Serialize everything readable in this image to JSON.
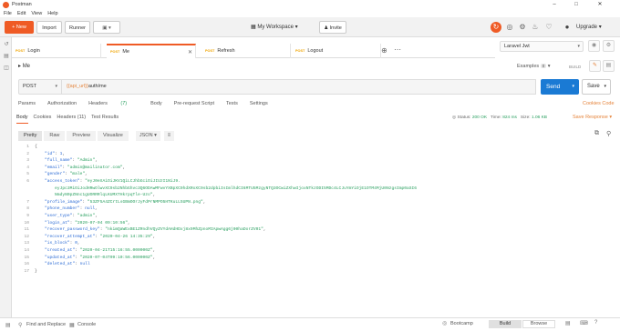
{
  "window": {
    "title": "Postman",
    "min_icon": "minimize-icon",
    "max_icon": "maximize-icon",
    "close_icon": "close-icon"
  },
  "menu": [
    "File",
    "Edit",
    "View",
    "Help"
  ],
  "toolbar": {
    "new_label": "New",
    "import_label": "Import",
    "runner_label": "Runner",
    "workspace_label": "My Workspace",
    "invite_label": "Invite",
    "upgrade_label": "Upgrade"
  },
  "tabs": [
    {
      "method": "POST",
      "name": "Login"
    },
    {
      "method": "POST",
      "name": "Me"
    },
    {
      "method": "POST",
      "name": "Refresh"
    },
    {
      "method": "POST",
      "name": "Logout"
    }
  ],
  "environment": {
    "selected": "Laravel Jwt"
  },
  "request": {
    "breadcrumb": "Me",
    "examples_label": "Examples",
    "examples_count": "0",
    "build_label": "BUILD",
    "method": "POST",
    "url_variable": "{{api_url}}",
    "url_path": "auth/me",
    "send_label": "Send",
    "save_label": "Save"
  },
  "request_tabs": [
    {
      "label": "Params"
    },
    {
      "label": "Authorization"
    },
    {
      "label": "Headers",
      "count": "(7)"
    },
    {
      "label": "Body"
    },
    {
      "label": "Pre-request Script"
    },
    {
      "label": "Tests"
    },
    {
      "label": "Settings"
    }
  ],
  "cookies_code_label": "Cookies  Code",
  "response": {
    "tabs": [
      "Body",
      "Cookies",
      "Headers (11)",
      "Test Results"
    ],
    "status_label": "Status:",
    "status_value": "200 OK",
    "time_label": "Time:",
    "time_value": "824 ms",
    "size_label": "Size:",
    "size_value": "1.06 KB",
    "save_response_label": "Save Response",
    "view_buttons": [
      "Pretty",
      "Raw",
      "Preview",
      "Visualize"
    ],
    "format": "JSON"
  },
  "code_lines": [
    [
      {
        "t": "p",
        "v": "{"
      }
    ],
    [
      {
        "t": "k",
        "v": "    \"id\""
      },
      {
        "t": "p",
        "v": ": "
      },
      {
        "t": "n",
        "v": "1"
      },
      {
        "t": "p",
        "v": ","
      }
    ],
    [
      {
        "t": "k",
        "v": "    \"full_name\""
      },
      {
        "t": "p",
        "v": ": "
      },
      {
        "t": "s",
        "v": "\"Admin\""
      },
      {
        "t": "p",
        "v": ","
      }
    ],
    [
      {
        "t": "k",
        "v": "    \"email\""
      },
      {
        "t": "p",
        "v": ": "
      },
      {
        "t": "s",
        "v": "\"admin@mailinator.com\""
      },
      {
        "t": "p",
        "v": ","
      }
    ],
    [
      {
        "t": "k",
        "v": "    \"gender\""
      },
      {
        "t": "p",
        "v": ": "
      },
      {
        "t": "s",
        "v": "\"male\""
      },
      {
        "t": "p",
        "v": ","
      }
    ],
    [
      {
        "t": "k",
        "v": "    \"access_token\""
      },
      {
        "t": "p",
        "v": ": "
      },
      {
        "t": "s",
        "v": "\"eyJ0eXAiOiJKV1QiLCJhbGciOiJIUzI1NiJ9."
      }
    ],
    [
      {
        "t": "s",
        "v": "        eyJpc3MiOiJodHRwOlwvXC9sb2NhbGhvc3Q6ODAwMFwvYXBpXC9hdXRoXC9sb2dpbiIsImlhdCI6MTU5MzgyNTQ3OCwiZXhwIjoxNTkzODI5MDc4LCJuYmYiOjE1OTM4MjU0NzgsImp0aSI6"
      }
    ],
    [
      {
        "t": "s",
        "v": "        NmdyN0pZNnc1gUORRRlqLKUMXTHkrpqTle-Uzo\""
      },
      {
        "t": "p",
        "v": ","
      }
    ],
    [
      {
        "t": "k",
        "v": "    \"profile_image\""
      },
      {
        "t": "p",
        "v": ": "
      },
      {
        "t": "s",
        "v": "\"53ZF5A4ZCrtLsGBmOOrJyFdPrNMPO5HTKuLL5UPN.png\""
      },
      {
        "t": "p",
        "v": ","
      }
    ],
    [
      {
        "t": "k",
        "v": "    \"phone_number\""
      },
      {
        "t": "p",
        "v": ": "
      },
      {
        "t": "n",
        "v": "null"
      },
      {
        "t": "p",
        "v": ","
      }
    ],
    [
      {
        "t": "k",
        "v": "    \"user_type\""
      },
      {
        "t": "p",
        "v": ": "
      },
      {
        "t": "s",
        "v": "\"admin\""
      },
      {
        "t": "p",
        "v": ","
      }
    ],
    [
      {
        "t": "k",
        "v": "    \"login_at\""
      },
      {
        "t": "p",
        "v": ": "
      },
      {
        "t": "s",
        "v": "\"2020-07-04 09:10:56\""
      },
      {
        "t": "p",
        "v": ","
      }
    ],
    [
      {
        "t": "k",
        "v": "    \"recover_password_key\""
      },
      {
        "t": "p",
        "v": ": "
      },
      {
        "t": "s",
        "v": "\"nkimQaWExBE1ZRndhVQyZVYdAHdHDxj8x9MhZpnoMIApwAgg6j00haDorZV01\""
      },
      {
        "t": "p",
        "v": ","
      }
    ],
    [
      {
        "t": "k",
        "v": "    \"recover_attempt_at\""
      },
      {
        "t": "p",
        "v": ": "
      },
      {
        "t": "s",
        "v": "\"2020-04-26 14:35:29\""
      },
      {
        "t": "p",
        "v": ","
      }
    ],
    [
      {
        "t": "k",
        "v": "    \"is_block\""
      },
      {
        "t": "p",
        "v": ": "
      },
      {
        "t": "n",
        "v": "0"
      },
      {
        "t": "p",
        "v": ","
      }
    ],
    [
      {
        "t": "k",
        "v": "    \"created_at\""
      },
      {
        "t": "p",
        "v": ": "
      },
      {
        "t": "s",
        "v": "\"2020-04-21T15:16:55.000000Z\""
      },
      {
        "t": "p",
        "v": ","
      }
    ],
    [
      {
        "t": "k",
        "v": "    \"updated_at\""
      },
      {
        "t": "p",
        "v": ": "
      },
      {
        "t": "s",
        "v": "\"2020-07-04T09:10:56.000000Z\""
      },
      {
        "t": "p",
        "v": ","
      }
    ],
    [
      {
        "t": "k",
        "v": "    \"deleted_at\""
      },
      {
        "t": "p",
        "v": ": "
      },
      {
        "t": "n",
        "v": "null"
      }
    ],
    [
      {
        "t": "p",
        "v": "}"
      }
    ]
  ],
  "line_numbers": [
    "1",
    "2",
    "3",
    "4",
    "5",
    "6",
    "",
    "",
    "7",
    "8",
    "9",
    "10",
    "11",
    "12",
    "13",
    "14",
    "15",
    "16",
    "17"
  ],
  "statusbar": {
    "find_replace": "Find and Replace",
    "console": "Console",
    "bootcamp": "Bootcamp",
    "build": "Build",
    "browse": "Browse"
  },
  "colors": {
    "accent": "#ef5b25",
    "send": "#1a7ad4",
    "status_ok": "#2aa060"
  }
}
